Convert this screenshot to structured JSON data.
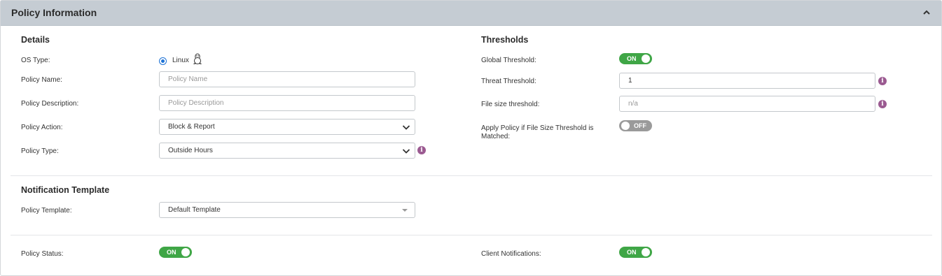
{
  "header": {
    "title": "Policy Information"
  },
  "details": {
    "title": "Details",
    "os_type": {
      "label": "OS Type:",
      "option": "Linux"
    },
    "policy_name": {
      "label": "Policy Name:",
      "placeholder": "Policy Name"
    },
    "policy_description": {
      "label": "Policy Description:",
      "placeholder": "Policy Description"
    },
    "policy_action": {
      "label": "Policy Action:",
      "value": "Block & Report"
    },
    "policy_type": {
      "label": "Policy Type:",
      "value": "Outside Hours"
    }
  },
  "thresholds": {
    "title": "Thresholds",
    "global_threshold": {
      "label": "Global Threshold:",
      "state": "ON"
    },
    "threat_threshold": {
      "label": "Threat Threshold:",
      "value": "1"
    },
    "file_size_threshold": {
      "label": "File size threshold:",
      "placeholder": "n/a"
    },
    "apply_policy": {
      "label": "Apply Policy if File Size Threshold is Matched:",
      "state": "OFF"
    }
  },
  "notification": {
    "title": "Notification Template",
    "policy_template": {
      "label": "Policy Template:",
      "value": "Default Template"
    }
  },
  "status": {
    "policy_status": {
      "label": "Policy Status:",
      "state": "ON"
    },
    "client_notifications": {
      "label": "Client Notifications:",
      "state": "ON"
    }
  },
  "colors": {
    "accent_green": "#3fa646",
    "info_purple": "#9b5a91",
    "header_bg": "#c5ccd3"
  },
  "icons": {
    "collapse": "chevron-up-icon",
    "os": "linux-tux-icon",
    "info": "info-icon"
  }
}
